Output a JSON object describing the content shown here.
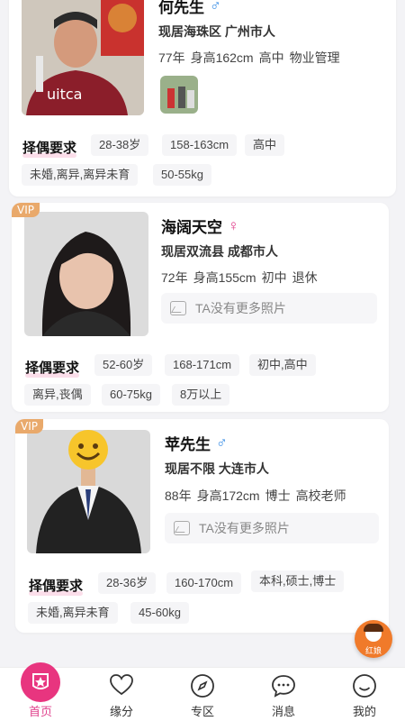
{
  "colors": {
    "accent": "#e8357f",
    "vip": "#e9a96b",
    "male": "#3a8ee6",
    "female": "#e0408c",
    "fab": "#f07a2a"
  },
  "cards": [
    {
      "vip": "",
      "name": "何先生",
      "gender_icon": "male-icon",
      "location": "现居海珠区  广州市人",
      "meta": [
        "77年",
        "身高162cm",
        "高中",
        "物业管理"
      ],
      "no_photo_text": "",
      "req_title": "择偶要求",
      "tags": [
        "28-38岁",
        "158-163cm",
        "高中",
        "未婚,离异,离异未育",
        "50-55kg"
      ]
    },
    {
      "vip": "VIP",
      "name": "海阔天空",
      "gender_icon": "female-icon",
      "location": "现居双流县  成都市人",
      "meta": [
        "72年",
        "身高155cm",
        "初中",
        "退休"
      ],
      "no_photo_text": "TA没有更多照片",
      "req_title": "择偶要求",
      "tags": [
        "52-60岁",
        "168-171cm",
        "初中,高中",
        "离异,丧偶",
        "60-75kg",
        "8万以上"
      ]
    },
    {
      "vip": "VIP",
      "name": "苹先生",
      "gender_icon": "male-icon",
      "location": "现居不限  大连市人",
      "meta": [
        "88年",
        "身高172cm",
        "博士",
        "高校老师"
      ],
      "no_photo_text": "TA没有更多照片",
      "req_title": "择偶要求",
      "tags": [
        "28-36岁",
        "160-170cm",
        "本科,硕士,博士",
        "未婚,离异未育",
        "45-60kg"
      ]
    }
  ],
  "fab": {
    "label": "红娘",
    "icon": "matchmaker-icon"
  },
  "tabbar": [
    {
      "label": "首页",
      "icon": "home-star-icon",
      "active": true
    },
    {
      "label": "缘分",
      "icon": "heart-icon",
      "active": false
    },
    {
      "label": "专区",
      "icon": "compass-icon",
      "active": false
    },
    {
      "label": "消息",
      "icon": "chat-icon",
      "active": false
    },
    {
      "label": "我的",
      "icon": "smile-icon",
      "active": false
    }
  ]
}
